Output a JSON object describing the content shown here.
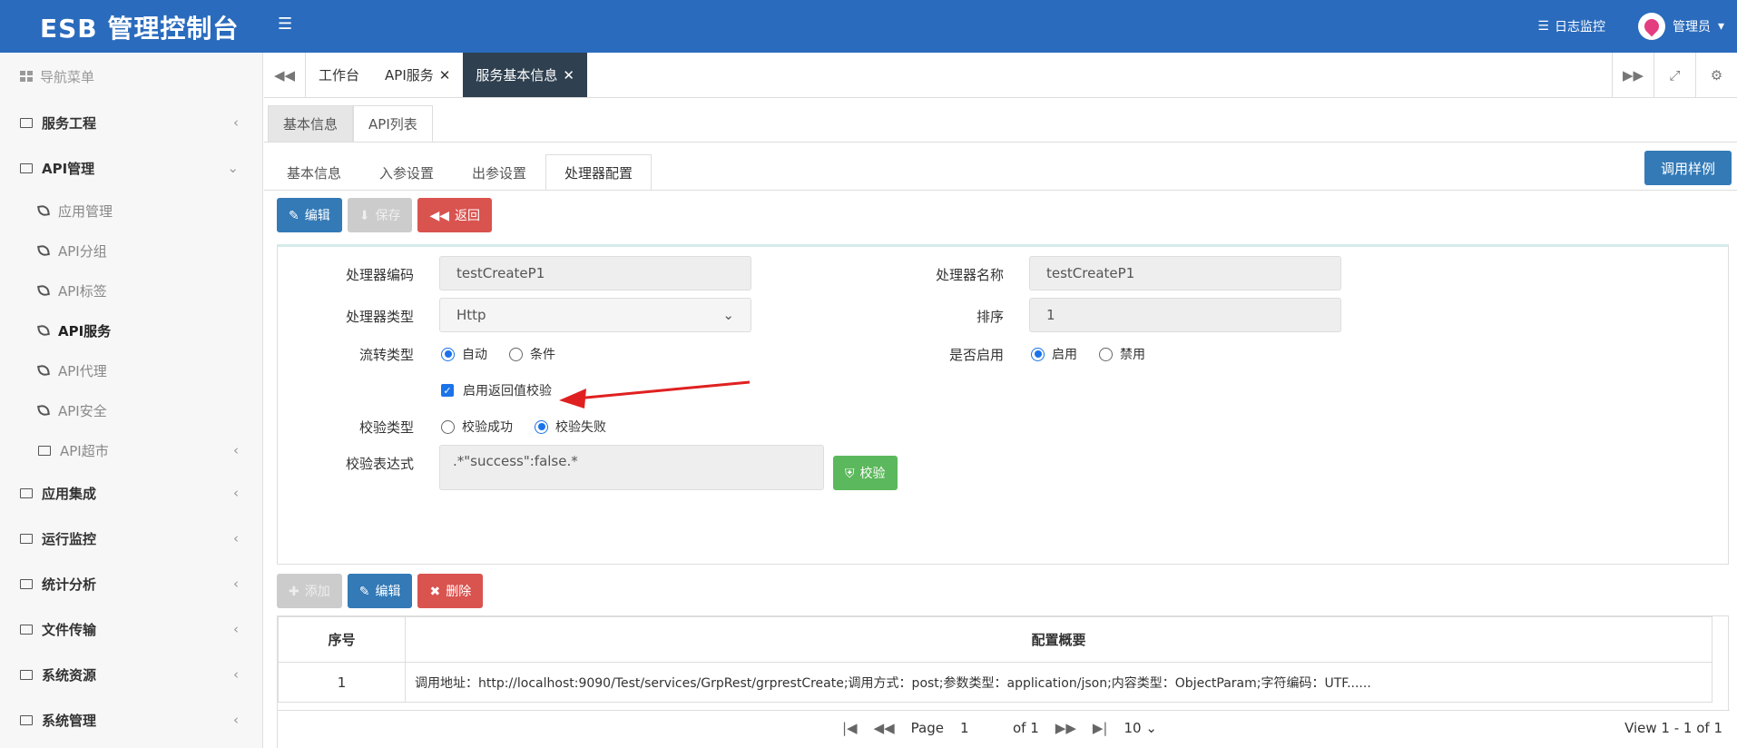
{
  "header": {
    "logo": "ESB 管理控制台",
    "menu_icon": "☰",
    "log_link": "日志监控",
    "user": "管理员"
  },
  "sidebar": {
    "title": "导航菜单",
    "groups": [
      {
        "label": "服务工程"
      },
      {
        "label": "API管理"
      },
      {
        "label": "应用集成"
      },
      {
        "label": "运行监控"
      },
      {
        "label": "统计分析"
      },
      {
        "label": "文件传输"
      },
      {
        "label": "系统资源"
      },
      {
        "label": "系统管理"
      }
    ],
    "api_items": [
      {
        "label": "应用管理"
      },
      {
        "label": "API分组"
      },
      {
        "label": "API标签"
      },
      {
        "label": "API服务"
      },
      {
        "label": "API代理"
      },
      {
        "label": "API安全"
      },
      {
        "label": "API超市"
      }
    ]
  },
  "tabs": {
    "items": [
      {
        "label": "工作台"
      },
      {
        "label": "API服务"
      },
      {
        "label": "服务基本信息"
      }
    ]
  },
  "subtabs1": [
    "基本信息",
    "API列表"
  ],
  "subtabs2": [
    "基本信息",
    "入参设置",
    "出参设置",
    "处理器配置"
  ],
  "sample_button": "调用样例",
  "toolbar1": {
    "edit": "编辑",
    "save": "保存",
    "back": "返回"
  },
  "form": {
    "code_label": "处理器编码",
    "code_value": "testCreateP1",
    "name_label": "处理器名称",
    "name_value": "testCreateP1",
    "type_label": "处理器类型",
    "type_value": "Http",
    "order_label": "排序",
    "order_value": "1",
    "flow_label": "流转类型",
    "flow_auto": "自动",
    "flow_cond": "条件",
    "enable_label": "是否启用",
    "enable_on": "启用",
    "enable_off": "禁用",
    "check_label": "启用返回值校验",
    "vtype_label": "校验类型",
    "vtype_success": "校验成功",
    "vtype_fail": "校验失败",
    "expr_label": "校验表达式",
    "expr_value": ".*\"success\":false.*",
    "verify_button": "校验"
  },
  "toolbar2": {
    "add": "添加",
    "edit": "编辑",
    "delete": "删除"
  },
  "grid": {
    "headers": [
      "序号",
      "配置概要"
    ],
    "rows": [
      {
        "no": "1",
        "summary": "调用地址：http://localhost:9090/Test/services/GrpRest/grprestCreate;调用方式：post;参数类型：application/json;内容类型：ObjectParam;字符编码：UTF......"
      }
    ]
  },
  "pager": {
    "page_label": "Page",
    "page_value": "1",
    "of_label": "of 1",
    "size": "10",
    "info": "View 1 - 1 of 1"
  },
  "colors": {
    "header": "#2a6bbd",
    "primary": "#337ab7",
    "danger": "#d9534f",
    "success": "#5cb85c",
    "active_tab": "#2f4050"
  }
}
